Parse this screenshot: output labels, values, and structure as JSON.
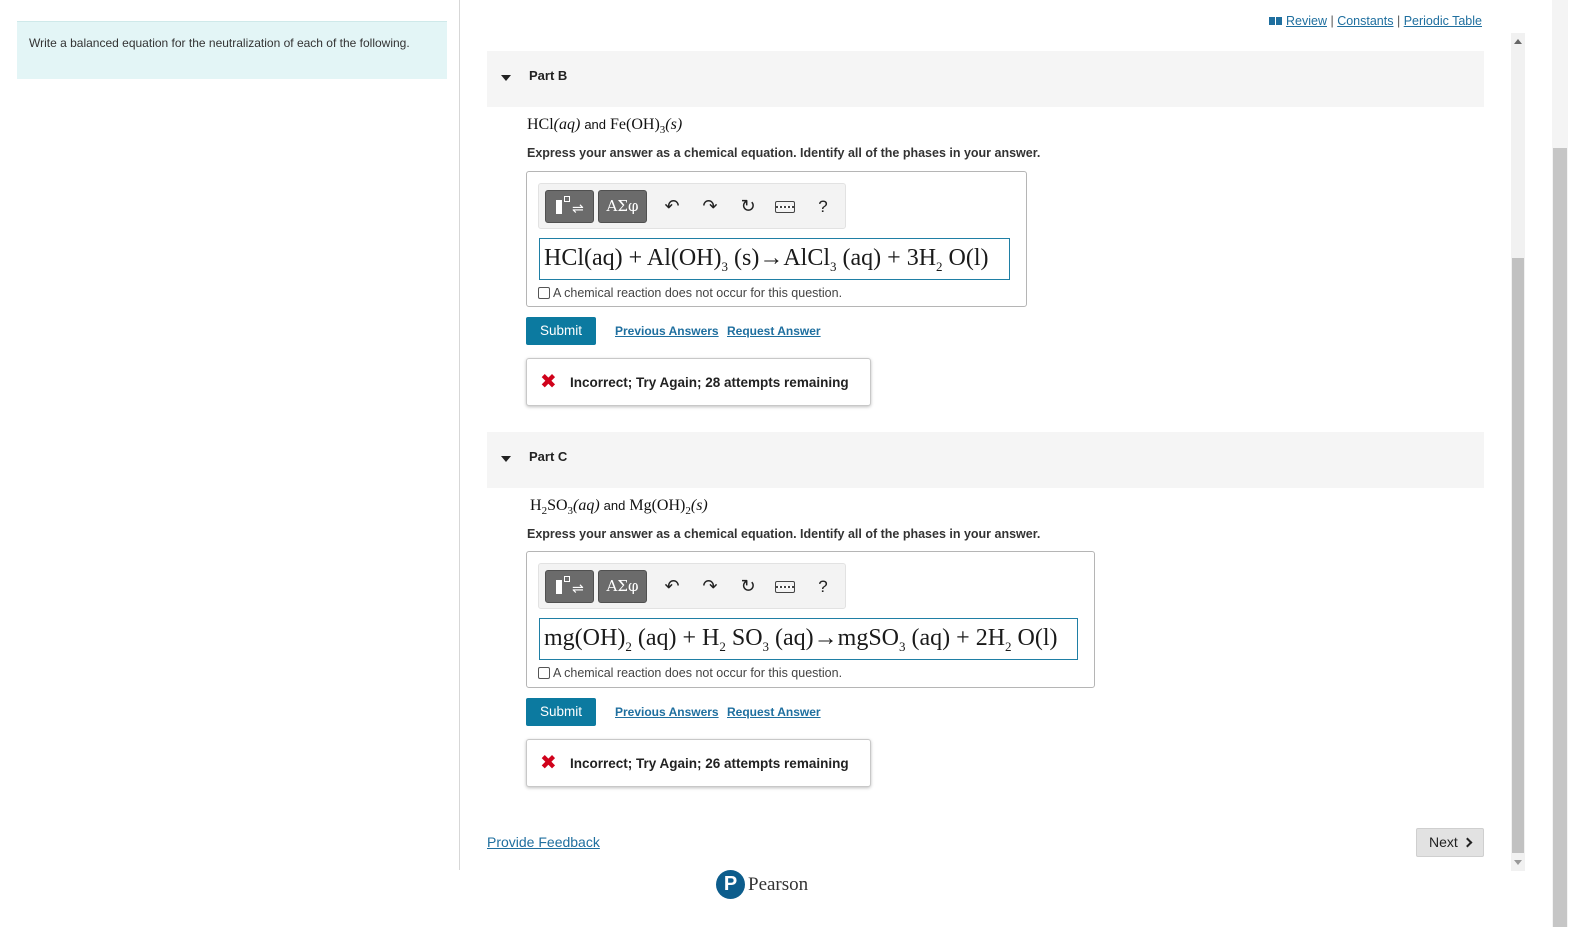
{
  "prompt": {
    "text": "Write a balanced equation for the neutralization of each of the following."
  },
  "header_links": {
    "review": "Review",
    "constants": "Constants",
    "periodic_table": "Periodic Table",
    "separator": "|"
  },
  "toolbar": {
    "greek_label": "ΑΣφ",
    "undo_glyph": "↶",
    "redo_glyph": "↷",
    "reset_glyph": "↻",
    "help_label": "?"
  },
  "no_reaction_label": "A chemical reaction does not occur for this question.",
  "submit_label": "Submit",
  "previous_answers_label": "Previous Answers",
  "request_answer_label": "Request Answer",
  "parts": [
    {
      "title": "Part B",
      "question": {
        "a": "HCl",
        "a_phase": "(aq)",
        "and": "and",
        "b": "Fe(OH)",
        "b_sub": "3",
        "b_phase": "(s)"
      },
      "instruction": "Express your answer as a chemical equation. Identify all of the phases in your answer.",
      "answer": {
        "p1": "HCl(aq) + Al(OH)",
        "s1": "3",
        "p2": " (s)→AlCl",
        "s2": "3",
        "p3": " (aq) + 3H",
        "s3": "2",
        "p4": " O(l)"
      },
      "feedback": "Incorrect; Try Again; 28 attempts remaining"
    },
    {
      "title": "Part C",
      "question": {
        "a": "H",
        "a_sub1": "2",
        "a_mid": "SO",
        "a_sub2": "3",
        "a_phase": "(aq)",
        "and": "and",
        "b": "Mg(OH)",
        "b_sub": "2",
        "b_phase": "(s)"
      },
      "instruction": "Express your answer as a chemical equation. Identify all of the phases in your answer.",
      "answer": {
        "p1": "mg(OH)",
        "s1": "2",
        "p2": " (aq) + H",
        "s2": "2",
        "p3": " SO",
        "s3": "3",
        "p4": " (aq)→mgSO",
        "s4": "3",
        "p5": " (aq) + 2H",
        "s5": "2",
        "p6": " O(l)"
      },
      "feedback": "Incorrect; Try Again; 26 attempts remaining"
    }
  ],
  "feedback_x": "✖",
  "provide_feedback_label": "Provide Feedback",
  "next_label": "Next",
  "brand": {
    "logo_letter": "P",
    "name": "Pearson"
  },
  "colors": {
    "accent": "#0c7aa0",
    "prompt_bg": "#e3f5f6",
    "error": "#d0021b",
    "link": "#1f6f9f"
  }
}
